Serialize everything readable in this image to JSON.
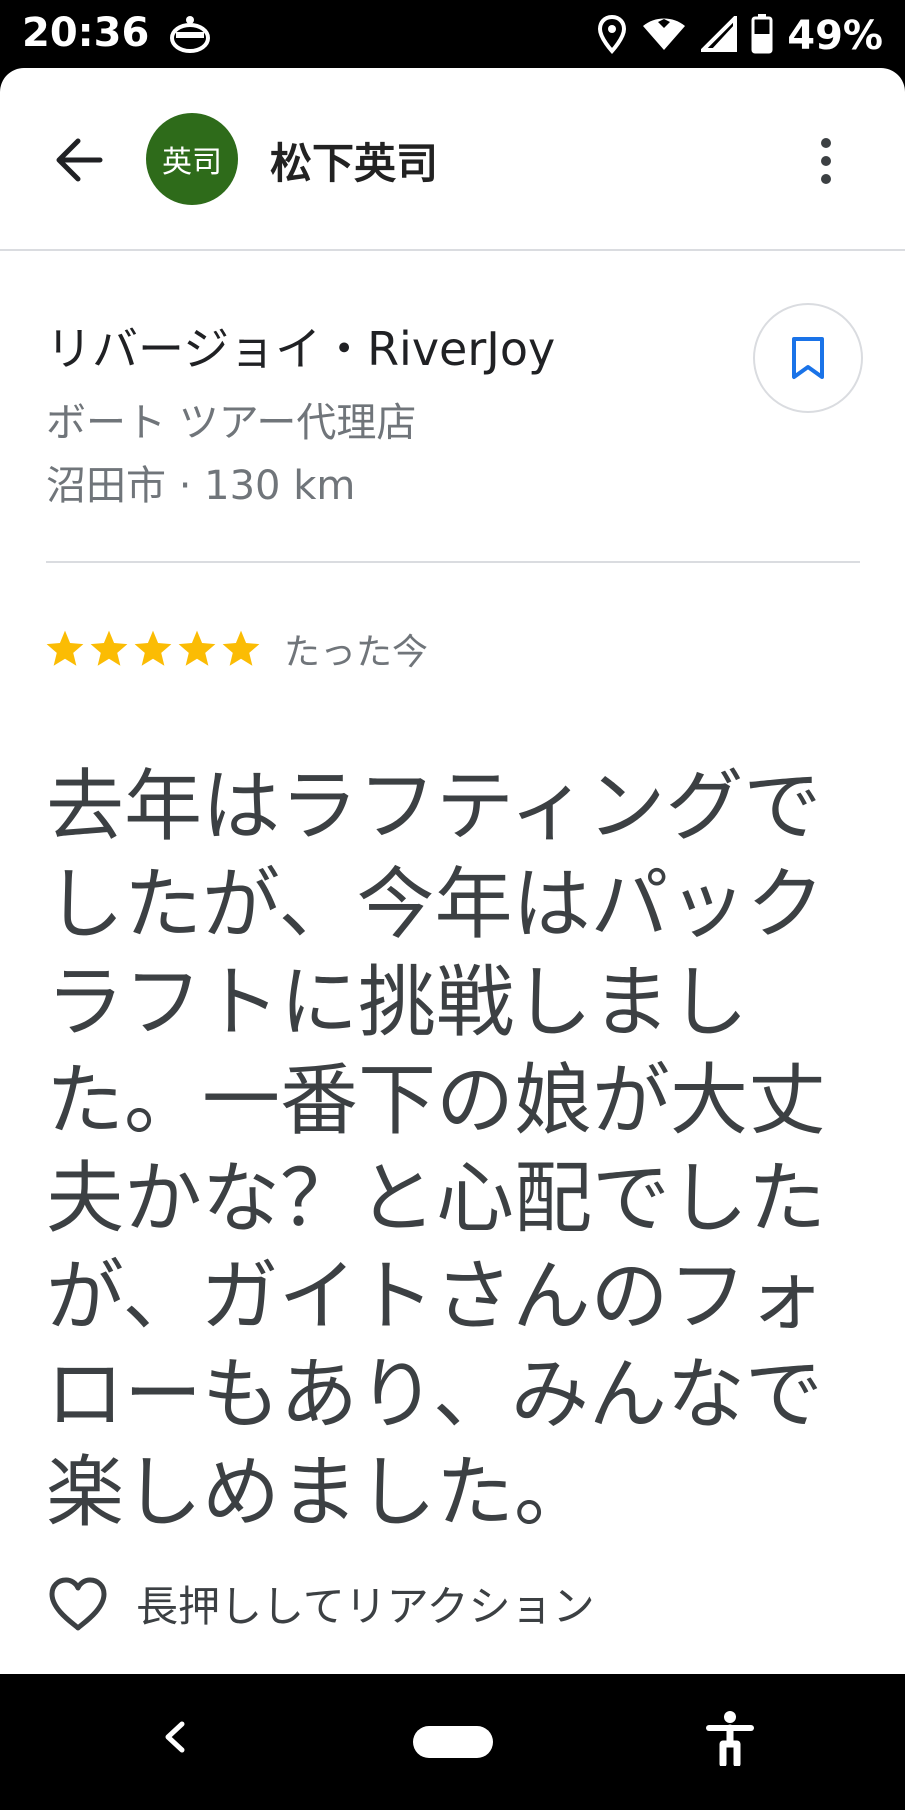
{
  "status_bar": {
    "time": "20:36",
    "battery": "49%",
    "icons": [
      "app-notification-icon",
      "location-icon",
      "wifi-icon",
      "signal-icon",
      "battery-icon"
    ]
  },
  "header": {
    "avatar_text": "英司",
    "avatar_color": "#2e6b1a",
    "user_name": "松下英司"
  },
  "place": {
    "name": "リバージョイ・RiverJoy",
    "category": "ボート ツアー代理店",
    "location": "沼田市 · 130 km"
  },
  "review": {
    "rating": 5,
    "max_rating": 5,
    "star_color": "#fbbc04",
    "time": "たった今",
    "text_lines": [
      "去年はラフティングで",
      "したが、今年はパック",
      "ラフトに挑戦しまし",
      "た。一番下の娘が大丈",
      "夫かな？と心配でした",
      "が、ガイトさんのフォ",
      "ローもあり、みんなで",
      "楽しめました。"
    ]
  },
  "reaction": {
    "label": "長押ししてリアクション"
  },
  "accent_color": "#1a73e8"
}
